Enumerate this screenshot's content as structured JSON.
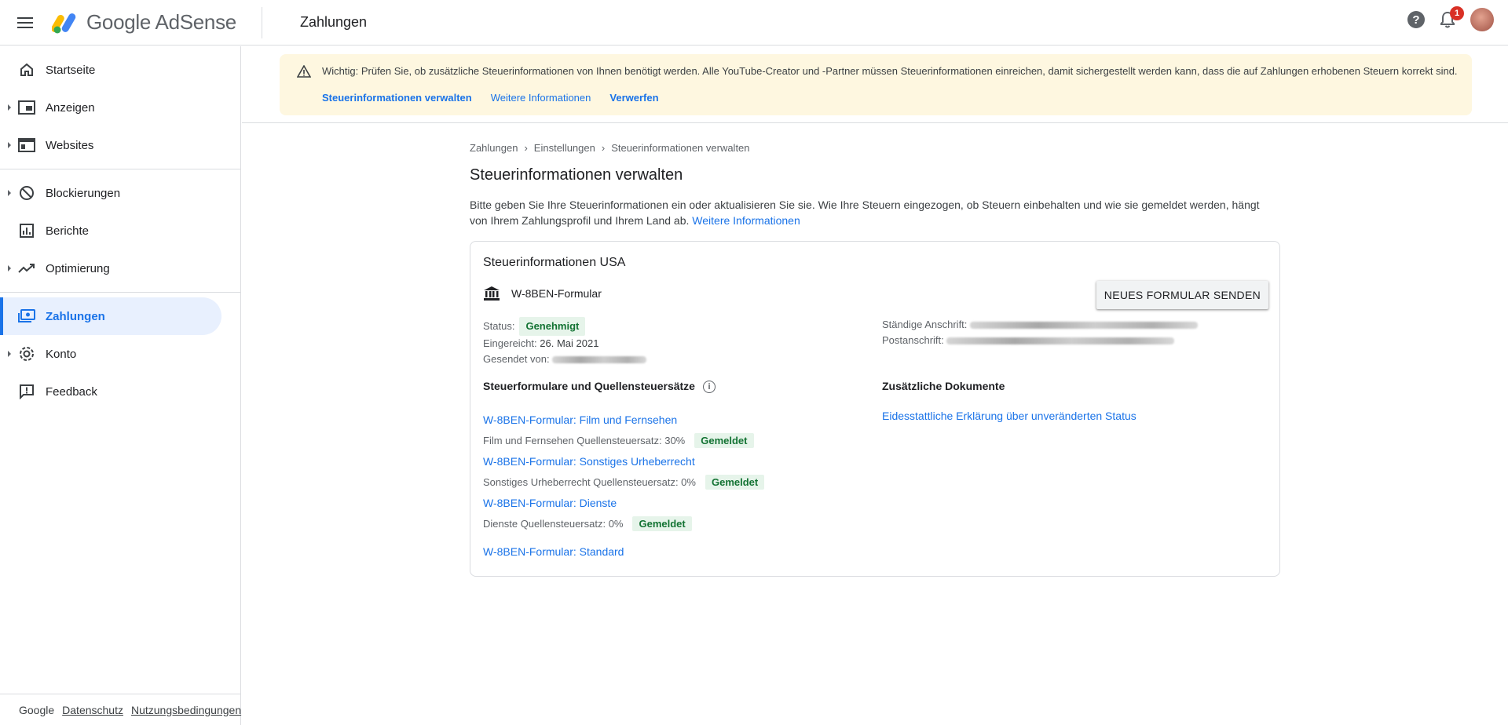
{
  "app": {
    "name": "Google AdSense",
    "page": "Zahlungen"
  },
  "topbar": {
    "notification_count": "1",
    "help": "?"
  },
  "sidebar": {
    "items": [
      {
        "label": "Startseite",
        "icon": "home-icon"
      },
      {
        "label": "Anzeigen",
        "icon": "ads-icon"
      },
      {
        "label": "Websites",
        "icon": "websites-icon"
      },
      {
        "label": "Blockierungen",
        "icon": "block-icon"
      },
      {
        "label": "Berichte",
        "icon": "reports-icon"
      },
      {
        "label": "Optimierung",
        "icon": "trending-icon"
      },
      {
        "label": "Zahlungen",
        "icon": "payments-icon"
      },
      {
        "label": "Konto",
        "icon": "gear-icon"
      },
      {
        "label": "Feedback",
        "icon": "feedback-icon"
      }
    ],
    "footer": {
      "brand": "Google",
      "privacy": "Datenschutz",
      "terms": "Nutzungsbedingungen"
    }
  },
  "banner": {
    "text": "Wichtig: Prüfen Sie, ob zusätzliche Steuerinformationen von Ihnen benötigt werden. Alle YouTube-Creator und -Partner müssen Steuerinformationen einreichen, damit sichergestellt werden kann, dass die auf Zahlungen erhobenen Steuern korrekt sind.",
    "link_manage": "Steuerinformationen verwalten",
    "link_more": "Weitere Informationen",
    "link_dismiss": "Verwerfen"
  },
  "breadcrumb": [
    "Zahlungen",
    "Einstellungen",
    "Steuerinformationen verwalten"
  ],
  "title": "Steuerinformationen verwalten",
  "intro": {
    "text": "Bitte geben Sie Ihre Steuerinformationen ein oder aktualisieren Sie sie. Wie Ihre Steuern eingezogen, ob Steuern einbehalten und wie sie gemeldet werden, hängt von Ihrem Zahlungsprofil und Ihrem Land ab.",
    "link": "Weitere Informationen"
  },
  "card": {
    "title": "Steuerinformationen USA",
    "form_name": "W-8BEN-Formular",
    "send_button": "NEUES FORMULAR SENDEN",
    "status_label": "Status:",
    "status_value": "Genehmigt",
    "submitted_label": "Eingereicht:",
    "submitted_value": "26. Mai 2021",
    "sent_by_label": "Gesendet von:",
    "permanent_address_label": "Ständige Anschrift:",
    "mailing_address_label": "Postanschrift:",
    "forms_section_title": "Steuerformulare und Quellensteuersätze",
    "docs_section_title": "Zusätzliche Dokumente",
    "docs_link": "Eidesstattliche Erklärung über unveränderten Status",
    "forms": [
      {
        "link": "W-8BEN-Formular: Film und Fernsehen",
        "rate": "Film und Fernsehen Quellensteuersatz: 30%",
        "status": "Gemeldet"
      },
      {
        "link": "W-8BEN-Formular: Sonstiges Urheberrecht",
        "rate": "Sonstiges Urheberrecht Quellensteuersatz: 0%",
        "status": "Gemeldet"
      },
      {
        "link": "W-8BEN-Formular: Dienste",
        "rate": "Dienste Quellensteuersatz: 0%",
        "status": "Gemeldet"
      }
    ],
    "standard_form_link": "W-8BEN-Formular: Standard"
  },
  "colors": {
    "accent": "#1a73e8",
    "banner_bg": "#fef7e0",
    "success_bg": "#e6f4ea",
    "success_text": "#137333"
  }
}
